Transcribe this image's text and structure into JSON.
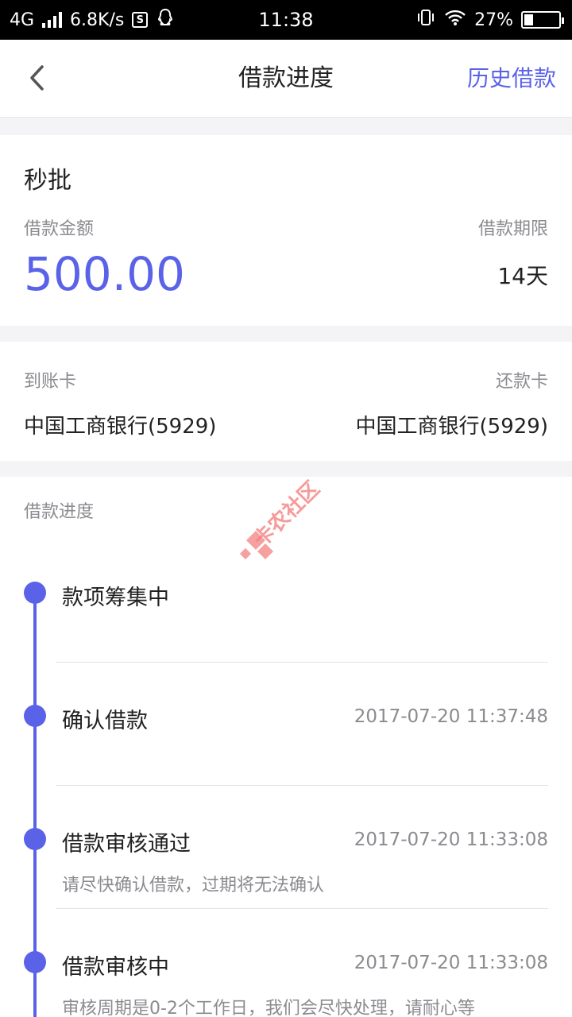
{
  "status_bar": {
    "network": "4G",
    "speed": "6.8K/s",
    "time": "11:38",
    "battery": "27%",
    "battery_level": 0.27
  },
  "nav": {
    "title": "借款进度",
    "right_label": "历史借款"
  },
  "loan": {
    "product": "秒批",
    "amount_label": "借款金额",
    "amount": "500.00",
    "term_label": "借款期限",
    "term": "14天"
  },
  "cards": {
    "receive_label": "到账卡",
    "receive_bank": "中国工商银行(5929)",
    "repay_label": "还款卡",
    "repay_bank": "中国工商银行(5929)"
  },
  "progress": {
    "title": "借款进度",
    "steps": [
      {
        "title": "款项筹集中",
        "time": "",
        "desc": ""
      },
      {
        "title": "确认借款",
        "time": "2017-07-20 11:37:48",
        "desc": ""
      },
      {
        "title": "借款审核通过",
        "time": "2017-07-20 11:33:08",
        "desc": "请尽快确认借款，过期将无法确认"
      },
      {
        "title": "借款审核中",
        "time": "2017-07-20 11:33:08",
        "desc": "审核周期是0-2个工作日，我们会尽快处理，请耐心等"
      }
    ]
  },
  "watermark_text": "卡农社区",
  "colors": {
    "accent": "#5a62e8",
    "watermark": "#f26b6b"
  }
}
